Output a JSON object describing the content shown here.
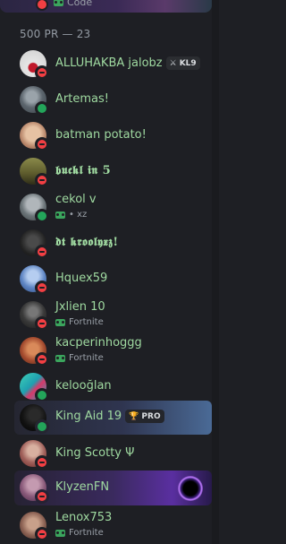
{
  "top_partial": {
    "activity": "Code"
  },
  "section": {
    "header": "500 PR — 23"
  },
  "members": [
    {
      "name": "ALLUHAKBA jalobz",
      "status": "dnd",
      "badge": "KL9",
      "badge_glyph": "⚔",
      "avatar_color": "#d8d8d8",
      "avatar_accent": "#c0182b"
    },
    {
      "name": "Artemas!",
      "status": "online",
      "avatar_color": "#6f7a84"
    },
    {
      "name": "batman potato!",
      "status": "dnd",
      "avatar_color": "#c9a48a"
    },
    {
      "name": "𝖇𝖚𝖈𝖐𝖑 𝖎𝖓 5",
      "status": "dnd",
      "avatar_color": "#6e6a3a"
    },
    {
      "name": "cekol v",
      "status": "online",
      "activity": "• xz",
      "avatar_color": "#7b858a"
    },
    {
      "name": "𝖉𝖙 𝖐𝖗𝖔𝖔𝖑𝖞𝖝𝖟!",
      "status": "dnd",
      "avatar_color": "#2a2a2a"
    },
    {
      "name": "Hquex59",
      "status": "dnd",
      "avatar_color": "#6a8fc8"
    },
    {
      "name": "Jxlien 10",
      "status": "dnd",
      "activity": "Fortnite",
      "avatar_color": "#3a3a3a"
    },
    {
      "name": "kacperinhoggg",
      "status": "dnd",
      "activity": "Fortnite",
      "avatar_color": "#b85a3a"
    },
    {
      "name": "kelooğlan",
      "status": "online",
      "avatar_color": "#2fb3a0"
    },
    {
      "name": "King Aid 19",
      "status": "online",
      "badge": "PRO",
      "badge_glyph": "🏆",
      "avatar_color": "#151515"
    },
    {
      "name": "King Scotty Ψ",
      "status": "dnd",
      "avatar_color": "#a8786a"
    },
    {
      "name": "KlyzenFN",
      "status": "dnd",
      "avatar_color": "#9b6a8a"
    },
    {
      "name": "Lenox753",
      "status": "dnd",
      "activity": "Fortnite",
      "avatar_color": "#8a6a5a"
    }
  ]
}
